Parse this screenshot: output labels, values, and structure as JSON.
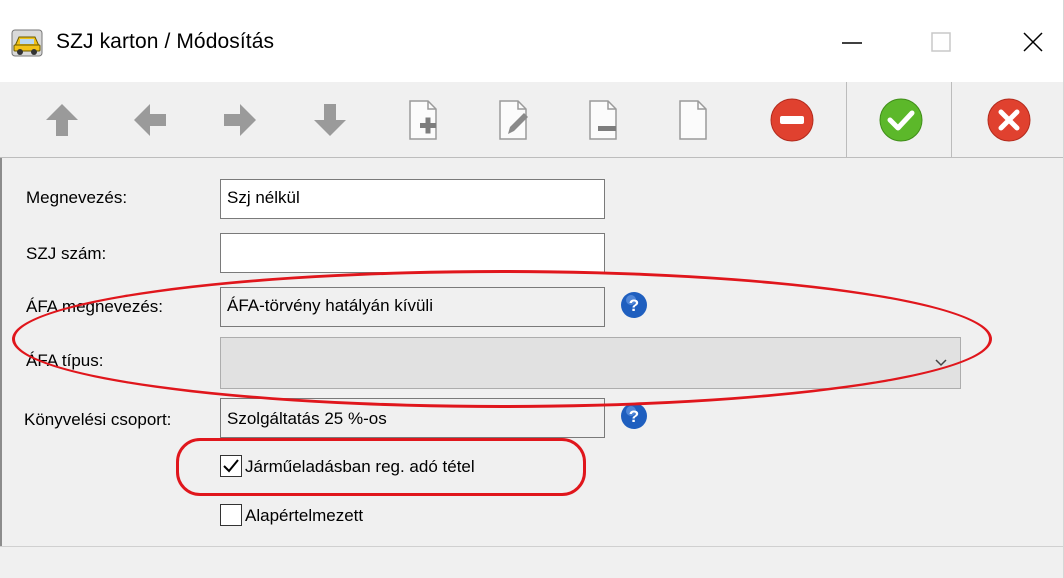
{
  "window": {
    "title": "SZJ karton / Módosítás",
    "app_icon": "car-icon"
  },
  "toolbar": {
    "buttons": [
      {
        "name": "first-record-button",
        "icon": "arrow-up-icon"
      },
      {
        "name": "previous-record-button",
        "icon": "arrow-left-icon"
      },
      {
        "name": "next-record-button",
        "icon": "arrow-right-icon"
      },
      {
        "name": "last-record-button",
        "icon": "arrow-down-icon"
      },
      {
        "name": "new-record-button",
        "icon": "document-add-icon"
      },
      {
        "name": "edit-record-button",
        "icon": "document-edit-icon"
      },
      {
        "name": "delete-record-button",
        "icon": "document-remove-icon"
      },
      {
        "name": "blank-document-button",
        "icon": "document-icon"
      },
      {
        "name": "cancel-edit-button",
        "icon": "red-minus-icon"
      },
      {
        "name": "ok-button",
        "icon": "green-check-icon"
      },
      {
        "name": "close-button",
        "icon": "red-x-icon"
      }
    ]
  },
  "form": {
    "name_label": "Megnevezés:",
    "name_value": "Szj nélkül",
    "szj_label": "SZJ szám:",
    "szj_value": "",
    "vat_name_label": "ÁFA megnevezés:",
    "vat_name_value": "ÁFA-törvény hatályán kívüli",
    "vat_type_label": "ÁFA típus:",
    "vat_type_value": "",
    "accounting_group_label": "Könyvelési csoport:",
    "accounting_group_value": "Szolgáltatás 25 %-os",
    "vehicle_sale_checkbox_label": "Járműeladásban reg. adó tétel",
    "vehicle_sale_checked": true,
    "default_checkbox_label": "Alapértelmezett",
    "default_checked": false
  },
  "colors": {
    "annotation_red": "#e0161c",
    "help_blue": "#1f5fbf",
    "ok_green": "#5cb82a",
    "cancel_red": "#e0412f"
  }
}
